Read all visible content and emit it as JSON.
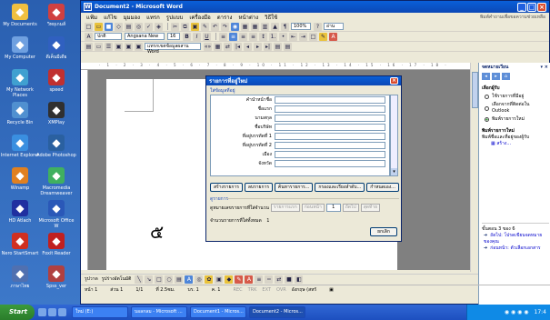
{
  "desktop_icons": [
    {
      "label": "My Documents",
      "color": "#f0c040"
    },
    {
      "label": "วิทยุเกมส์",
      "color": "#d04040"
    },
    {
      "label": "My Computer",
      "color": "#6fa0e0"
    },
    {
      "label": "ดีเค็นมีเดีย",
      "color": "#3060c0"
    },
    {
      "label": "My Network Places",
      "color": "#40a0d0"
    },
    {
      "label": "speed",
      "color": "#c03030"
    },
    {
      "label": "Recycle Bin",
      "color": "#5090d0"
    },
    {
      "label": "XMPlay",
      "color": "#303030"
    },
    {
      "label": "Internet Explorer",
      "color": "#3a8fe0"
    },
    {
      "label": "Adobe Photoshop",
      "color": "#2a60a0"
    },
    {
      "label": "Winamp",
      "color": "#e08020"
    },
    {
      "label": "Macromedia Dreamweaver",
      "color": "#40b060"
    },
    {
      "label": "HD Atlach",
      "color": "#2030a0"
    },
    {
      "label": "Microsoft Office W",
      "color": "#2a58b8"
    },
    {
      "label": "Nero StartSmart",
      "color": "#d03020"
    },
    {
      "label": "Foxit Reader",
      "color": "#c02020"
    },
    {
      "label": "ภาษาไทย",
      "color": "#5070b0"
    },
    {
      "label": "Spss_ver",
      "color": "#b04040"
    }
  ],
  "window": {
    "title": "Document2 - Microsoft Word",
    "menu": [
      "แฟ้ม",
      "แก้ไข",
      "มุมมอง",
      "แทรก",
      "รูปแบบ",
      "เครื่องมือ",
      "ตาราง",
      "หน้าต่าง",
      "วิธีใช้"
    ],
    "menu_hint": "พิมพ์คำถามเพื่อขอความช่วยเหลือ",
    "style_value": "ปกติ",
    "font_value": "Angsana New",
    "size_value": "16",
    "zoom_value": "100%",
    "view_label": "อ่าน",
    "merge_label": "แทรกเขตข้อมูลผสาน Word"
  },
  "document": {
    "big_char": "๕"
  },
  "taskpane": {
    "title": "จดหมายเวียน",
    "section1": "เลือกผู้รับ",
    "options": [
      "ใช้รายการที่มีอยู่",
      "เลือกจากที่ติดต่อใน Outlook",
      "พิมพ์รายการใหม่"
    ],
    "section2": "พิมพ์รายการใหม่",
    "section2_desc": "พิมพ์ชื่อและที่อยู่ของผู้รับ",
    "create_link": "สร้าง...",
    "step": "ขั้นตอน 3 ของ 6",
    "next": "ถัดไป: โปรดเขียนจดหมายของคุณ",
    "prev": "ก่อนหน้า: ตัวเลือกเอกสาร"
  },
  "dialog": {
    "title": "รายการที่อยู่ใหม่",
    "group_label": "ใส่ข้อมูลที่อยู่",
    "fields": [
      "คำนำหน้าชื่อ",
      "ชื่อแรก",
      "นามสกุล",
      "ชื่อบริษัท",
      "ที่อยู่บรรทัดที่ 1",
      "ที่อยู่บรรทัดที่ 2",
      "เมือง",
      "จังหวัด"
    ],
    "buttons": [
      "สร้างรายการ",
      "ลบรายการ",
      "ค้นหารายการ...",
      "กรองและเรียงลำดับ...",
      "กำหนดเอง..."
    ],
    "view_group": "ดูรายการ",
    "view_label": "ดูหมายเลขรายการที่ใส่จำนวน",
    "nav_first": "รายการแรก",
    "nav_prev": "ก่อนหน้า",
    "record_number": "1",
    "nav_next": "ถัดไป",
    "nav_last": "สุดท้าย",
    "count_label": "จำนวนรายการที่ใส่ทั้งหมด",
    "count_value": "1",
    "cancel": "ยกเลิก"
  },
  "drawbar": {
    "draw_label": "รูปวาด",
    "autoshapes_label": "รูปร่างอัตโนมัติ"
  },
  "status": {
    "page": "หน้า 1",
    "section": "ส่วน 1",
    "pages": "1/1",
    "position": "ที่ 2.5ซม.",
    "line": "บร. 1",
    "col": "ค. 1",
    "rec": "REC",
    "trk": "TRK",
    "ext": "EXT",
    "ovr": "OVR",
    "language": "อังกฤษ (สหรั"
  },
  "taskbar": {
    "start": "Start",
    "tasks": [
      "ใหม่ (E:)",
      "บอลกลม - Microsoft ...",
      "Document1 - Micros...",
      "Document2 - Micros..."
    ],
    "active_task": 3,
    "clock": "17:4"
  }
}
